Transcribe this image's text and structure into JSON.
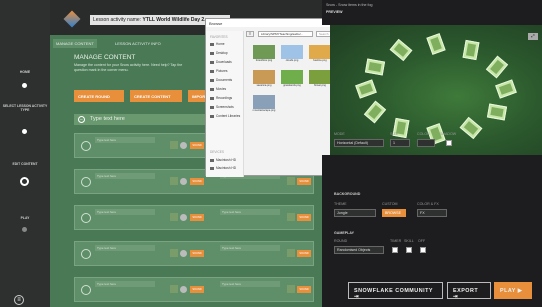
{
  "rail": {
    "items": [
      {
        "label": "HOME"
      },
      {
        "label": "SELECT LESSON ACTIVITY TYPE"
      },
      {
        "label": "EDIT CONTENT"
      },
      {
        "label": "PLAY"
      }
    ]
  },
  "header": {
    "activity_label": "Lesson activity name:",
    "activity_value": "YTLL World Wildlife Day 2..."
  },
  "tabs": [
    "MANAGE CONTENT",
    "LESSON ACTIVITY INFO"
  ],
  "manage": {
    "heading": "MANAGE CONTENT",
    "desc": "Manage the content for your Snow activity here. Need help? Tap the question mark in the corner menu.",
    "buttons": [
      "CREATE ROUND",
      "CREATE CONTENT",
      "IMPORT"
    ],
    "type_placeholder": "Type text here",
    "row_text": "Type text here",
    "sound": "SOUND"
  },
  "dialog": {
    "title": "Browse",
    "path": "Library/SPMYTeaching/audio/...",
    "search": "Search",
    "favorites_label": "FAVORITES",
    "sidebar": [
      "Home",
      "Desktop",
      "Downloads",
      "Pictures",
      "Documents",
      "Movies",
      "Recordings",
      "Screenshots",
      "Content Libraries"
    ],
    "devices_label": "DEVICES",
    "devices": [
      "Macintosh HD",
      "Macintosh HD"
    ],
    "files": [
      "forestfloor.png",
      "clouds.png",
      "beeline.png",
      "underwater.png",
      "savanna.png",
      "grasslands.png",
      "flower.png",
      "jungle.png",
      "mountainscape.png",
      "lily.png"
    ]
  },
  "preview": {
    "caption": "Snow - Snow items in the fog",
    "label": "PREVIEW"
  },
  "settings": {
    "row1_labels": [
      "MODE",
      "SIZE",
      "COLOR",
      "SHADOW"
    ],
    "mode_value": "Horizontal (Default)",
    "size_value": "1",
    "background_label": "BACKGROUND",
    "bg_labels": [
      "THEME",
      "CUSTOM",
      "COLOR & FX"
    ],
    "theme_value": "Jungle",
    "browse": "BROWSE",
    "fx_value": "FX",
    "gameplay_label": "GAMEPLAY",
    "gameplay_labels": [
      "ROUND",
      "TIMER",
      "SKILL",
      "OFF"
    ],
    "round_value": "Randomised Objects"
  },
  "actions": {
    "community": "SNOWFLAKE COMMUNITY",
    "export": "EXPORT",
    "play": "PLAY"
  },
  "colors": {
    "accent": "#e88f3c",
    "green": "#4a7a55"
  }
}
